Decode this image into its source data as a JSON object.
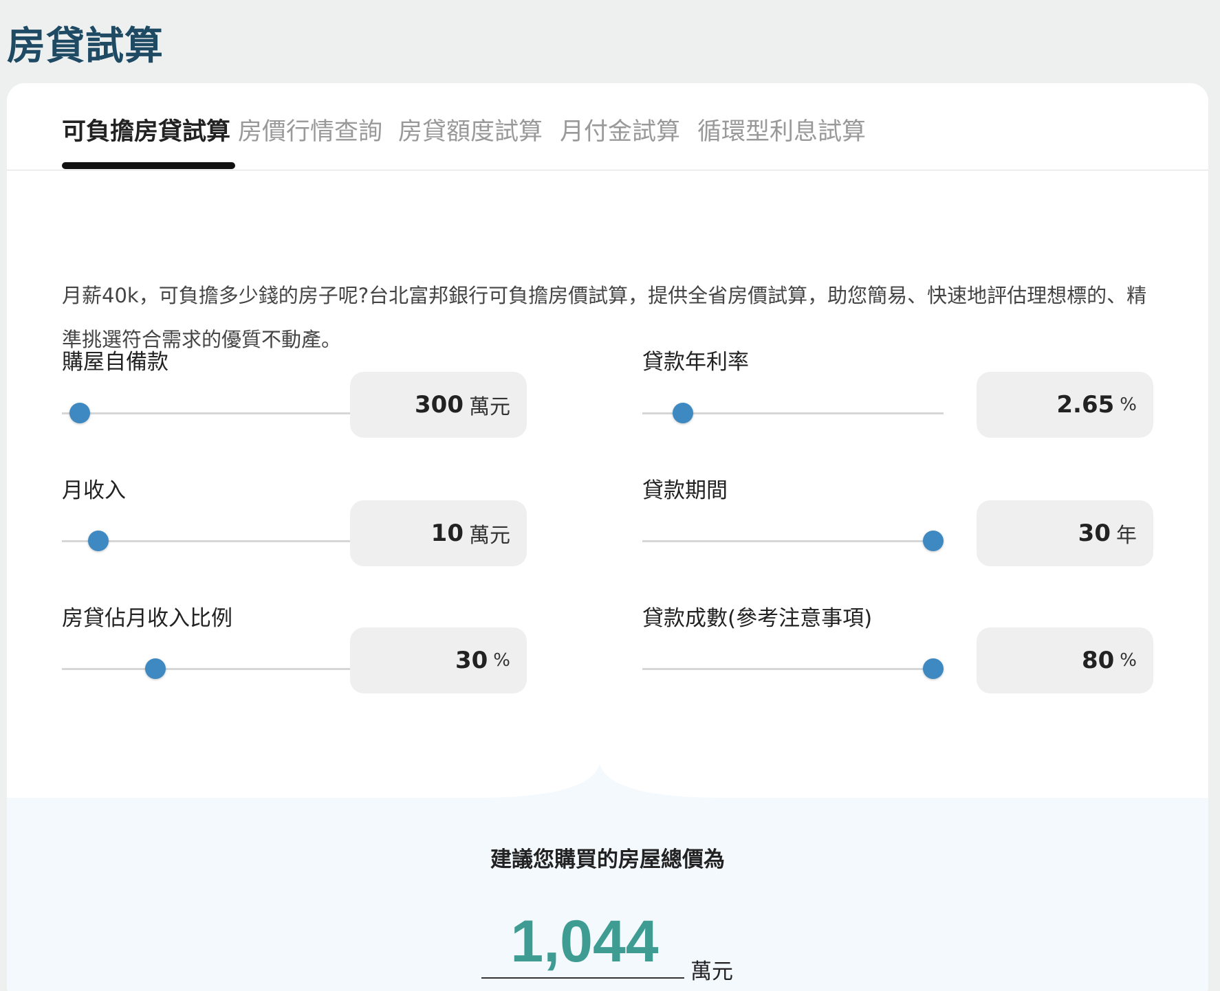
{
  "page": {
    "title": "房貸試算"
  },
  "tabs": [
    {
      "label": "可負擔房貸試算",
      "active": true
    },
    {
      "label": "房價行情查詢",
      "active": false
    },
    {
      "label": "房貸額度試算",
      "active": false
    },
    {
      "label": "月付金試算",
      "active": false
    },
    {
      "label": "循環型利息試算",
      "active": false
    }
  ],
  "description": "月薪40k，可負擔多少錢的房子呢?台北富邦銀行可負擔房價試算，提供全省房價試算，助您簡易、快速地評估理想標的、精準挑選符合需求的優質不動產。",
  "fields": {
    "down_payment": {
      "label": "購屋自備款",
      "value": "300",
      "unit": "萬元",
      "slider_fraction": 0.06
    },
    "monthly_income": {
      "label": "月收入",
      "value": "10",
      "unit": "萬元",
      "slider_fraction": 0.12
    },
    "loan_ratio": {
      "label": "房貸佔月收入比例",
      "value": "30",
      "unit": "%",
      "slider_fraction": 0.31
    },
    "interest_rate": {
      "label": "貸款年利率",
      "value": "2.65",
      "unit": "%",
      "slider_fraction": 0.135
    },
    "loan_term": {
      "label": "貸款期間",
      "value": "30",
      "unit": "年",
      "slider_fraction": 0.965
    },
    "loan_percent": {
      "label": "貸款成數(參考注意事項)",
      "value": "80",
      "unit": "%",
      "slider_fraction": 0.965
    }
  },
  "result": {
    "title": "建議您購買的房屋總價為",
    "value": "1,044",
    "unit": "萬元"
  },
  "colors": {
    "title": "#1e4a64",
    "slider_thumb": "#3e89c1",
    "result_value": "#3e9c93",
    "result_bg": "#f3f9fd"
  }
}
